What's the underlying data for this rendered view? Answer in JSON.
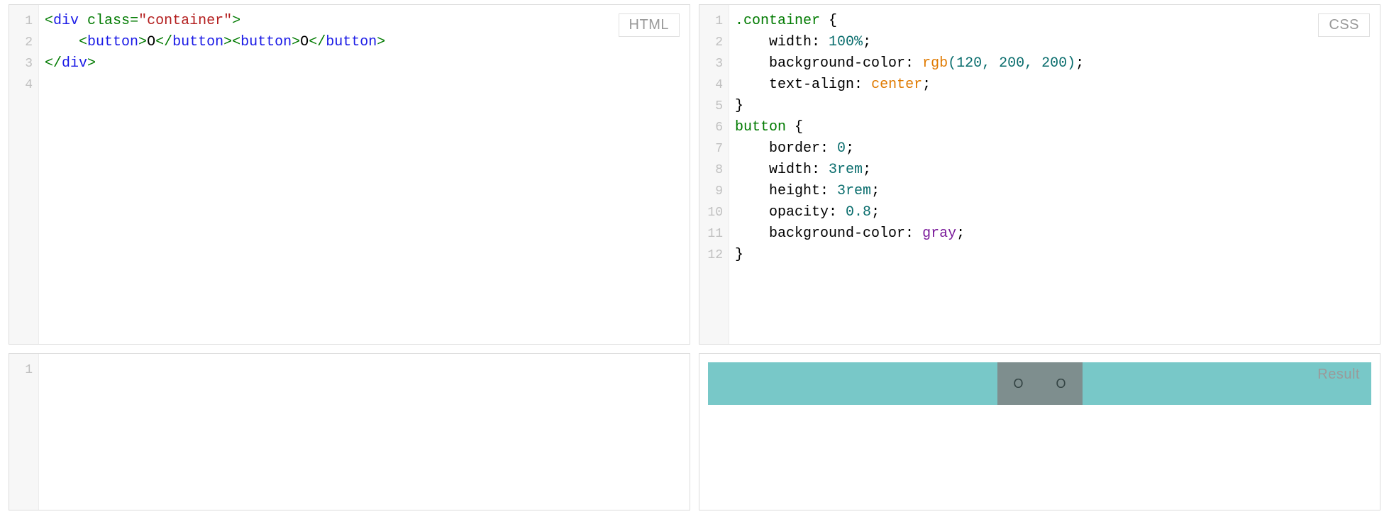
{
  "labels": {
    "html": "HTML",
    "css": "CSS",
    "js": "",
    "result": "Result"
  },
  "editors": {
    "html": {
      "line_numbers": [
        "1",
        "2",
        "3",
        "4"
      ],
      "lines": {
        "l1": {
          "open_lt": "<",
          "tag": "div",
          "space": " ",
          "attr": "class",
          "eq": "=",
          "q1": "\"",
          "val": "container",
          "q2": "\"",
          "open_gt": ">"
        },
        "l2": {
          "indent": "    ",
          "b1_open_lt": "<",
          "b1_tag": "button",
          "b1_open_gt": ">",
          "b1_text": "O",
          "b1_close": "</",
          "b1_ctag": "button",
          "b1_cgt": ">",
          "b2_open_lt": "<",
          "b2_tag": "button",
          "b2_open_gt": ">",
          "b2_text": "O",
          "b2_close": "</",
          "b2_ctag": "button",
          "b2_cgt": ">"
        },
        "l3": {
          "close_lt": "</",
          "tag": "div",
          "close_gt": ">"
        }
      }
    },
    "css": {
      "line_numbers": [
        "1",
        "2",
        "3",
        "4",
        "5",
        "6",
        "7",
        "8",
        "9",
        "10",
        "11",
        "12"
      ],
      "lines": {
        "l1": {
          "sel": ".container",
          "sp": " ",
          "brace": "{"
        },
        "l2": {
          "indent": "    ",
          "prop": "width",
          "colon": ": ",
          "val": "100%",
          "semi": ";"
        },
        "l3": {
          "indent": "    ",
          "prop": "background-color",
          "colon": ": ",
          "func": "rgb",
          "args": "(120, 200, 200)",
          "semi": ";"
        },
        "l4": {
          "indent": "    ",
          "prop": "text-align",
          "colon": ": ",
          "kw": "center",
          "semi": ";"
        },
        "l5": {
          "brace": "}"
        },
        "l6": {
          "sel": "button",
          "sp": " ",
          "brace": "{"
        },
        "l7": {
          "indent": "    ",
          "prop": "border",
          "colon": ": ",
          "val": "0",
          "semi": ";"
        },
        "l8": {
          "indent": "    ",
          "prop": "width",
          "colon": ": ",
          "val": "3rem",
          "semi": ";"
        },
        "l9": {
          "indent": "    ",
          "prop": "height",
          "colon": ": ",
          "val": "3rem",
          "semi": ";"
        },
        "l10": {
          "indent": "    ",
          "prop": "opacity",
          "colon": ": ",
          "val": "0.8",
          "semi": ";"
        },
        "l11": {
          "indent": "    ",
          "prop": "background-color",
          "colon": ": ",
          "color": "gray",
          "semi": ";"
        },
        "l12": {
          "brace": "}"
        }
      }
    },
    "js": {
      "line_numbers": [
        "1"
      ]
    }
  },
  "result": {
    "container_bg": "rgb(120, 200, 200)",
    "button_bg": "gray",
    "button_opacity": "0.8",
    "button_size": "3rem",
    "buttons": [
      "O",
      "O"
    ]
  }
}
